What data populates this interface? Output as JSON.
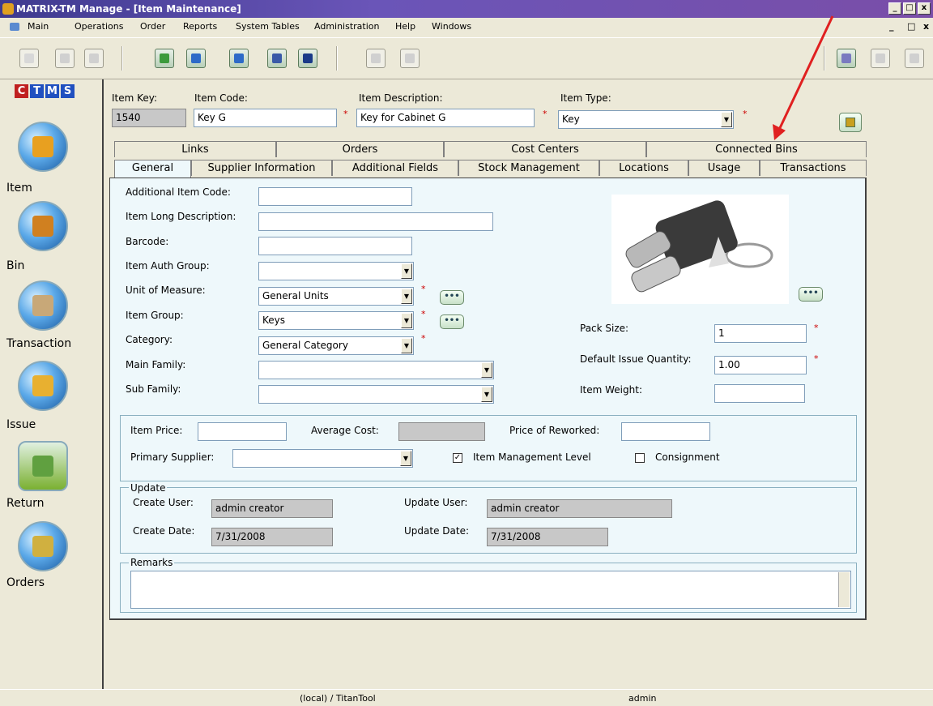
{
  "window": {
    "title": "MATRIX-TM Manage - [Item Maintenance]",
    "min_glyph": "_",
    "max_glyph": "□",
    "close_glyph": "x"
  },
  "menu": {
    "items": [
      "Main",
      "Operations",
      "Order",
      "Reports",
      "System Tables",
      "Administration",
      "Help",
      "Windows"
    ]
  },
  "sidebar": {
    "logo_letters": [
      "C",
      "T",
      "M",
      "S"
    ],
    "items": [
      {
        "label": "Item",
        "icon": "item-icon"
      },
      {
        "label": "Bin",
        "icon": "bin-icon"
      },
      {
        "label": "Transaction",
        "icon": "transaction-icon"
      },
      {
        "label": "Issue",
        "icon": "issue-icon"
      },
      {
        "label": "Return",
        "icon": "return-icon"
      },
      {
        "label": "Orders",
        "icon": "orders-icon"
      }
    ]
  },
  "header": {
    "item_key_label": "Item Key:",
    "item_key_value": "1540",
    "item_code_label": "Item Code:",
    "item_code_value": "Key G",
    "item_desc_label": "Item Description:",
    "item_desc_value": "Key for Cabinet G",
    "item_type_label": "Item Type:",
    "item_type_value": "Key"
  },
  "tabs": {
    "row1": [
      "Links",
      "Orders",
      "Cost Centers",
      "Connected Bins"
    ],
    "row2": [
      "General",
      "Supplier Information",
      "Additional Fields",
      "Stock Management",
      "Locations",
      "Usage",
      "Transactions"
    ],
    "selected": "General"
  },
  "general": {
    "additional_item_code_label": "Additional Item Code:",
    "additional_item_code_value": "",
    "long_desc_label": "Item Long Description:",
    "long_desc_value": "",
    "barcode_label": "Barcode:",
    "barcode_value": "",
    "auth_group_label": "Item Auth Group:",
    "auth_group_value": "",
    "uom_label": "Unit of Measure:",
    "uom_value": "General Units",
    "item_group_label": "Item Group:",
    "item_group_value": "Keys",
    "category_label": "Category:",
    "category_value": "General Category",
    "main_family_label": "Main Family:",
    "main_family_value": "",
    "sub_family_label": "Sub Family:",
    "sub_family_value": "",
    "pack_size_label": "Pack Size:",
    "pack_size_value": "1",
    "default_issue_qty_label": "Default Issue Quantity:",
    "default_issue_qty_value": "1.00",
    "item_weight_label": "Item Weight:",
    "item_weight_value": "",
    "ellipsis": "•••",
    "required_mark": "*"
  },
  "price": {
    "item_price_label": "Item Price:",
    "item_price_value": "",
    "avg_cost_label": "Average Cost:",
    "avg_cost_value": "",
    "reworked_label": "Price of Reworked:",
    "reworked_value": "",
    "primary_supplier_label": "Primary Supplier:",
    "primary_supplier_value": "",
    "item_mgmt_label": "Item Management Level",
    "item_mgmt_checked": true,
    "consignment_label": "Consignment",
    "consignment_checked": false,
    "checked_glyph": "✓"
  },
  "update": {
    "group_label": "Update",
    "create_user_label": "Create User:",
    "create_user_value": "admin creator",
    "update_user_label": "Update User:",
    "update_user_value": "admin creator",
    "create_date_label": "Create Date:",
    "create_date_value": "7/31/2008",
    "update_date_label": "Update Date:",
    "update_date_value": "7/31/2008"
  },
  "remarks": {
    "group_label": "Remarks",
    "value": ""
  },
  "status": {
    "server": "(local) / TitanTool",
    "user": "admin"
  }
}
